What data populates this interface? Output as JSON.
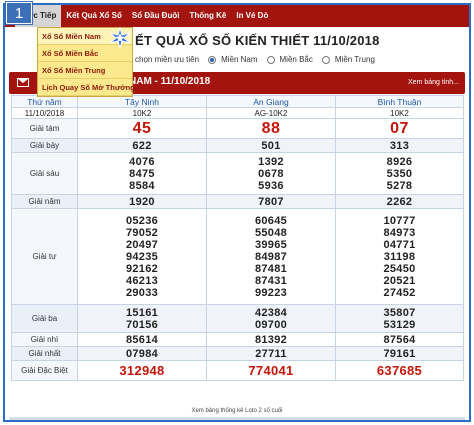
{
  "step": {
    "number": "1"
  },
  "nav": {
    "home": "H",
    "items": [
      {
        "label": "Trực Tiếp",
        "active": true
      },
      {
        "label": "Kết Quả Xổ Số",
        "active": false
      },
      {
        "label": "Sổ Đầu Đuôi",
        "active": false
      },
      {
        "label": "Thống Kê",
        "active": false
      },
      {
        "label": "In Vé Dò",
        "active": false
      }
    ]
  },
  "dropdown": {
    "items": [
      "Xổ Số Miền Nam",
      "Xổ Số Miền Bắc",
      "Xổ Số Miền Trung",
      "Lịch Quay Số Mở Thưởng"
    ]
  },
  "page": {
    "title": "ẾT QUẢ XỔ SỐ KIẾN THIẾT 11/10/2018",
    "filter_text": "chọn miền ưu tiên",
    "regions": [
      {
        "label": "Miền Nam",
        "checked": true
      },
      {
        "label": "Miền Bắc",
        "checked": false
      },
      {
        "label": "Miền Trung",
        "checked": false
      }
    ]
  },
  "band": {
    "title": "NAM - 11/10/2018",
    "link": "Xem bảng tỉnh..."
  },
  "table": {
    "headers": [
      "Thứ năm",
      "Tây Ninh",
      "An Giang",
      "Bình Thuận"
    ],
    "date": "11/10/2018",
    "codes": [
      "10K2",
      "AG-10K2",
      "10K2"
    ],
    "rows": [
      {
        "label": "Giải tám",
        "values": [
          [
            "45"
          ],
          [
            "88"
          ],
          [
            "07"
          ]
        ]
      },
      {
        "label": "Giải bảy",
        "values": [
          [
            "622"
          ],
          [
            "501"
          ],
          [
            "313"
          ]
        ]
      },
      {
        "label": "Giải sáu",
        "values": [
          [
            "4076",
            "8475",
            "8584"
          ],
          [
            "1392",
            "0678",
            "5936"
          ],
          [
            "8926",
            "5350",
            "5278"
          ]
        ]
      },
      {
        "label": "Giải năm",
        "values": [
          [
            "1920"
          ],
          [
            "7807"
          ],
          [
            "2262"
          ]
        ]
      },
      {
        "label": "Giải tư",
        "values": [
          [
            "05236",
            "79052",
            "20497",
            "94235",
            "92162",
            "46213",
            "29033"
          ],
          [
            "60645",
            "55048",
            "39965",
            "84987",
            "87481",
            "87431",
            "99223"
          ],
          [
            "10777",
            "84973",
            "04771",
            "31198",
            "25450",
            "20521",
            "27452"
          ]
        ]
      },
      {
        "label": "Giải ba",
        "values": [
          [
            "15161",
            "70156"
          ],
          [
            "42384",
            "09700"
          ],
          [
            "35807",
            "53129"
          ]
        ]
      },
      {
        "label": "Giải nhì",
        "values": [
          [
            "85614"
          ],
          [
            "81392"
          ],
          [
            "87564"
          ]
        ]
      },
      {
        "label": "Giải nhất",
        "values": [
          [
            "07984"
          ],
          [
            "27711"
          ],
          [
            "79161"
          ]
        ]
      },
      {
        "label": "Giải Đặc Biệt",
        "values": [
          [
            "312948"
          ],
          [
            "774041"
          ],
          [
            "637685"
          ]
        ]
      }
    ]
  },
  "footer": {
    "text": "Xem bảng thống kê Loto 2 số cuối"
  },
  "colors": {
    "accent": "#a3140f",
    "prize": "#c2160b",
    "link": "#1d56a8"
  }
}
